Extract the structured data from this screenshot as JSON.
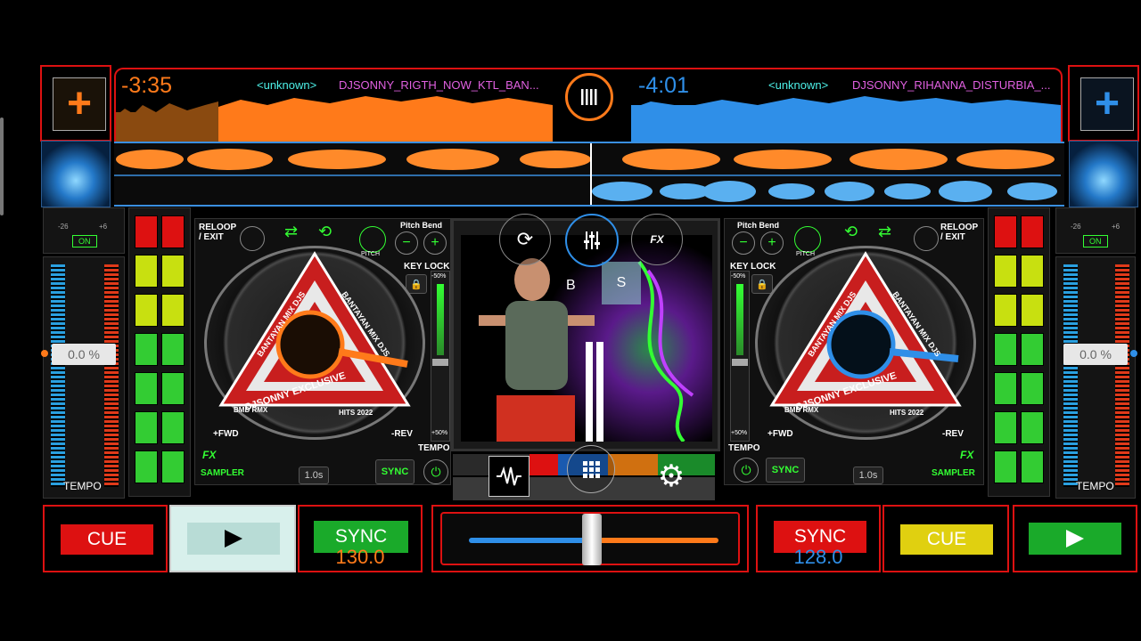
{
  "deck_a": {
    "time_remaining": "-3:35",
    "artist": "<unknown>",
    "track_title": "DJSONNY_RIGTH_NOW_KTL_BAN...",
    "accent": "#ff7a1a",
    "reloop_label": "RELOOP\n/ EXIT",
    "pitch_bend_label": "Pitch Bend",
    "pitch_label": "PITCH",
    "key_lock_label": "KEY LOCK",
    "range_top": "-50%",
    "range_bottom": "+50%",
    "tempo_label": "TEMPO",
    "pitch_value": "0.0 %",
    "on_label": "ON",
    "knob_min": "-26",
    "knob_max": "+6",
    "fwd_label": "+FWD",
    "rev_label": "-REV",
    "fx_label": "FX",
    "sampler_label": "SAMPLER",
    "loop_len": "1.0s",
    "sync_small": "SYNC",
    "cue_label": "CUE",
    "sync_label": "SYNC",
    "bpm": "130.0",
    "side_tempo_label": "TEMPO"
  },
  "deck_b": {
    "time_remaining": "-4:01",
    "artist": "<unknown>",
    "track_title": "DJSONNY_RIHANNA_DISTURBIA_...",
    "accent": "#2f8fe8",
    "reloop_label": "RELOOP\n/ EXIT",
    "pitch_bend_label": "Pitch Bend",
    "pitch_label": "PITCH",
    "key_lock_label": "KEY LOCK",
    "range_top": "-50%",
    "range_bottom": "+50%",
    "tempo_label": "TEMPO",
    "pitch_value": "0.0 %",
    "on_label": "ON",
    "knob_min": "-26",
    "knob_max": "+6",
    "fwd_label": "+FWD",
    "rev_label": "-REV",
    "fx_label": "FX",
    "sampler_label": "SAMPLER",
    "loop_len": "1.0s",
    "sync_small": "SYNC",
    "cue_label": "CUE",
    "sync_label": "SYNC",
    "bpm": "128.0",
    "side_tempo_label": "TEMPO"
  },
  "record_label": {
    "line1": "BANTAYAN MIX DJS",
    "line2": "BANTAYAN MIX DJS",
    "line3": "DJSONNY EXCLUSIVE",
    "line4": "BMD RMX",
    "line5": "HITS 2022"
  },
  "center": {
    "fx_button": "FX",
    "video_b_label": "B",
    "video_s_label": "S"
  },
  "icons": {
    "add_track": "plus-icon",
    "menu": "bars-icon",
    "sync_rotate": "rotate-icon",
    "mixer": "sliders-icon",
    "waveform": "waveform-icon",
    "grid": "grid-icon",
    "settings": "gear-icon",
    "play": "play-icon",
    "lock": "lock-icon",
    "shuffle": "shuffle-icon",
    "repeat": "repeat-icon"
  },
  "crossfader": {
    "position": 0.5
  }
}
